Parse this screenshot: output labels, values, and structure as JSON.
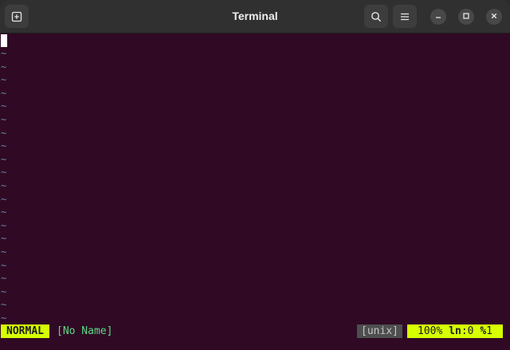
{
  "window": {
    "title": "Terminal"
  },
  "titlebar": {
    "new_tab_icon": "new-tab-icon",
    "search_icon": "search-icon",
    "menu_icon": "hamburger-menu-icon",
    "minimize_icon": "minimize-icon",
    "maximize_icon": "maximize-icon",
    "close_icon": "close-icon"
  },
  "editor": {
    "empty_line_marker": "~",
    "empty_line_count": 21
  },
  "statusline": {
    "mode": "NORMAL",
    "filename": "[No Name]",
    "fileformat": "[unix]",
    "percent": "100%",
    "line_label": "ln",
    "line_value": ":0",
    "col_label": "%",
    "col_value": "1"
  },
  "colors": {
    "terminal_bg": "#300a24",
    "titlebar_bg": "#303030",
    "tilde": "#5f87af",
    "mode_bg": "#d7ff00",
    "filename": "#5fd787",
    "fileformat_bg": "#4e4e4e"
  }
}
